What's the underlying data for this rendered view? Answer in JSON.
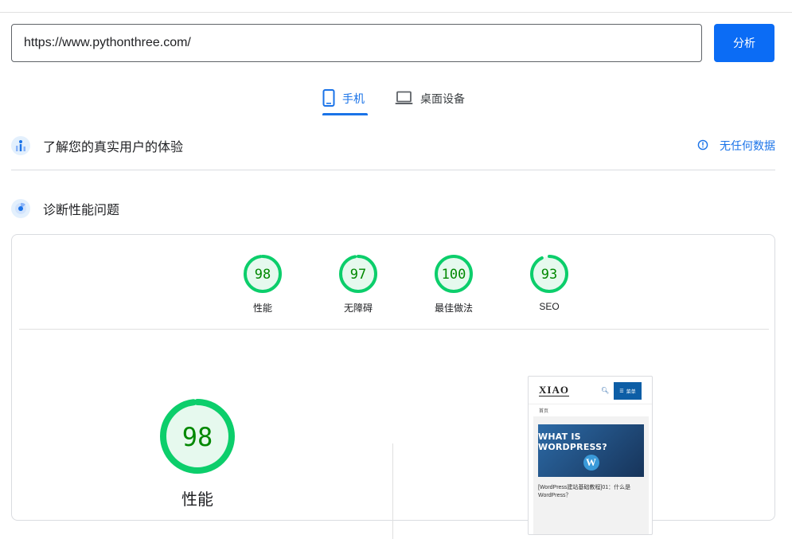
{
  "search": {
    "url_value": "https://www.pythonthree.com/",
    "analyze_label": "分析"
  },
  "tabs": [
    {
      "label": "手机",
      "icon": "smartphone-icon",
      "active": true
    },
    {
      "label": "桌面设备",
      "icon": "laptop-icon",
      "active": false
    }
  ],
  "field_data": {
    "title": "了解您的真实用户的体验",
    "icon": "people-chart-icon",
    "no_data_label": "无任何数据",
    "no_data_icon": "info-icon"
  },
  "diagnostics": {
    "title": "诊断性能问题",
    "icon": "lighthouse-radar-icon"
  },
  "scores": [
    {
      "value": 98,
      "label": "性能"
    },
    {
      "value": 97,
      "label": "无障碍"
    },
    {
      "value": 100,
      "label": "最佳做法"
    },
    {
      "value": 93,
      "label": "SEO"
    }
  ],
  "main_score": {
    "value": 98,
    "label": "性能"
  },
  "preview": {
    "logo": "XIAO",
    "menu_label": "菜单",
    "breadcrumb": "首页",
    "image_title": "WHAT IS WORDPRESS?",
    "image_logo": "W",
    "article_text": "[WordPress建站基础教程]01：什么是WordPress？"
  },
  "colors": {
    "accent": "#1a73e8",
    "button": "#0b6cf5",
    "pass_green": "#0cce6b",
    "pass_text": "#008800",
    "pass_fill": "#e6f9ee"
  }
}
